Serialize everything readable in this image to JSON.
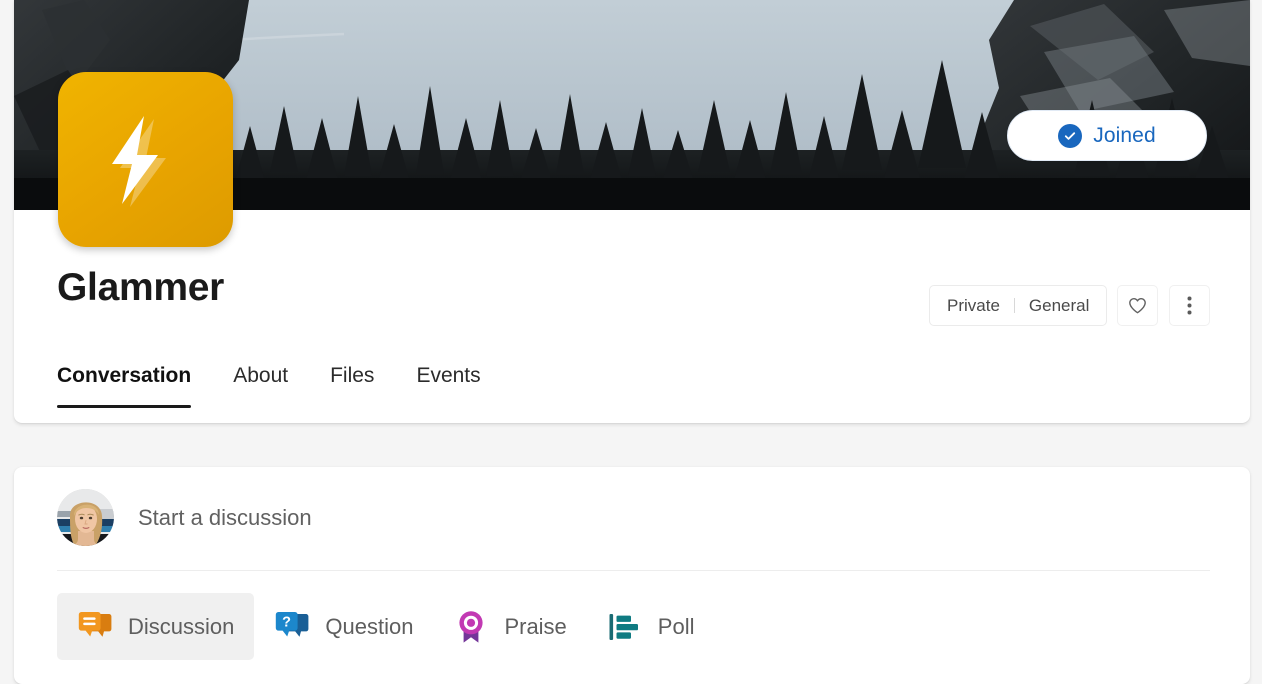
{
  "banner": {
    "name": "community-cover-photo",
    "alt": "Dark silhouetted pine forest against a pale blue sky with a snowy mountain cliff on the right",
    "sky_color": "#b9c6cf",
    "forest_color": "#141718",
    "rock_color": "#2a2d30"
  },
  "join_button": {
    "label": "Joined",
    "icon": "check-circle-icon",
    "accent_color": "#1967be",
    "state": "joined"
  },
  "community": {
    "logo_icon": "lightning-bolt-icon",
    "logo_color": "#e8a400",
    "logo_bolt_color": "#ffffff",
    "title": "Glammer",
    "privacy": "Private",
    "network": "General"
  },
  "actions": {
    "favorite_icon": "heart-icon",
    "more_icon": "more-vertical-icon"
  },
  "tabs": [
    {
      "label": "Conversation",
      "active": true
    },
    {
      "label": "About",
      "active": false
    },
    {
      "label": "Files",
      "active": false
    },
    {
      "label": "Events",
      "active": false
    }
  ],
  "composer": {
    "avatar_icon": "user-avatar",
    "avatar_alt": "Profile photo of a woman with blonde hair",
    "placeholder": "Start a discussion",
    "post_types": [
      {
        "label": "Discussion",
        "icon": "discussion-bubble-icon",
        "selected": true,
        "color": "#f2971f",
        "color_dark": "#d97d10"
      },
      {
        "label": "Question",
        "icon": "question-bubble-icon",
        "selected": false,
        "color": "#1c87cc",
        "color_dark": "#1a5f96"
      },
      {
        "label": "Praise",
        "icon": "praise-ribbon-icon",
        "selected": false,
        "color": "#c239b3",
        "color_dark": "#743699"
      },
      {
        "label": "Poll",
        "icon": "poll-bars-icon",
        "selected": false,
        "color": "#0f7b82",
        "color_dark": "#1a6b73"
      }
    ]
  }
}
